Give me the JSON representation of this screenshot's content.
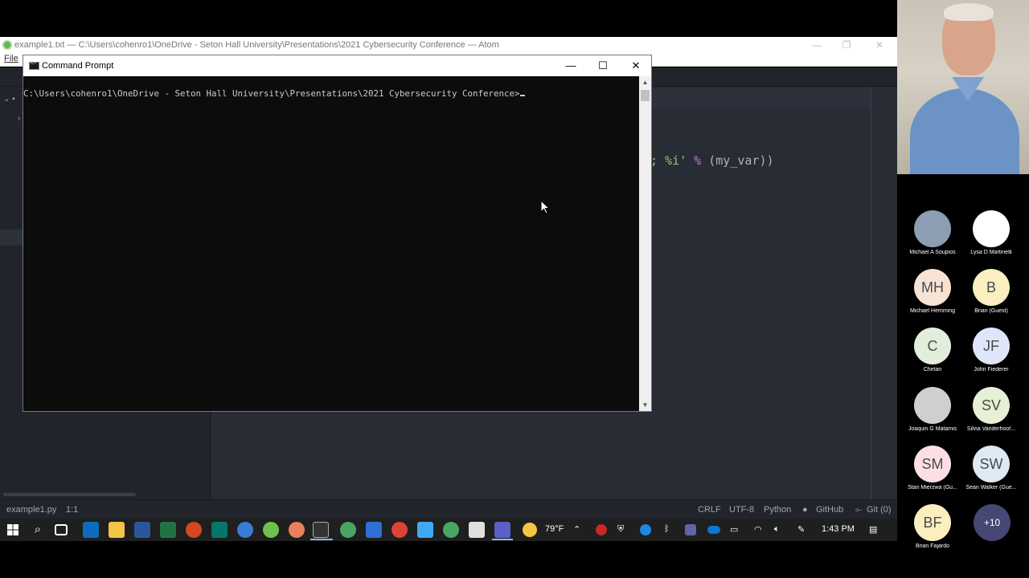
{
  "atom": {
    "window_title": "example1.txt — C:\\Users\\cohenro1\\OneDrive - Seton Hall University\\Presentations\\2021 Cybersecurity Conference — Atom",
    "menu_file": "File",
    "code_fragment": {
      "part1": "; %i'",
      "part2": " % ",
      "part3": "(my_var))"
    },
    "status": {
      "file": "example1.py",
      "cursor": "1:1",
      "line_ending": "CRLF",
      "encoding": "UTF-8",
      "grammar": "Python",
      "github": "GitHub",
      "git": "Git (0)"
    }
  },
  "cmd": {
    "title": "Command Prompt",
    "prompt": "C:\\Users\\cohenro1\\OneDrive - Seton Hall University\\Presentations\\2021 Cybersecurity Conference>"
  },
  "taskbar": {
    "temperature": "79°F",
    "time": "1:43 PM"
  },
  "participants": [
    {
      "initials": "",
      "name": "Michael A Soupios",
      "color": "#8d9db2"
    },
    {
      "initials": "",
      "name": "Lysa D Martinelli",
      "color": "#ffffff"
    },
    {
      "initials": "MH",
      "name": "Michael Hemming",
      "color": "#f7e3d4"
    },
    {
      "initials": "B",
      "name": "Brian (Guest)",
      "color": "#fbeec0"
    },
    {
      "initials": "C",
      "name": "Chetan",
      "color": "#e2eedb"
    },
    {
      "initials": "JF",
      "name": "John Fiederer",
      "color": "#dfe6f9"
    },
    {
      "initials": "",
      "name": "Joaquin G Matamis",
      "color": "#cfcfcf"
    },
    {
      "initials": "SV",
      "name": "Silvia Vanderhoof...",
      "color": "#e6f0d6"
    },
    {
      "initials": "SM",
      "name": "Stan Mierzwa (Gu...",
      "color": "#fbdfe3"
    },
    {
      "initials": "SW",
      "name": "Sean Walker (Gue...",
      "color": "#dde9f3"
    },
    {
      "initials": "BF",
      "name": "Brian Fajardo",
      "color": "#fbeec0"
    }
  ],
  "more_participants": "+10"
}
